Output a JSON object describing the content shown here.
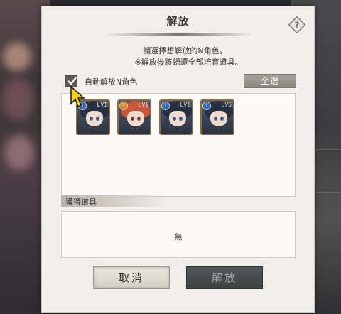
{
  "dialog": {
    "title": "解放",
    "instruction_line1": "請選擇想解放的N角色。",
    "instruction_line2": "※解放後將歸還全部培育道具。"
  },
  "auto_release": {
    "label": "自動解放N角色",
    "checked": true
  },
  "select_all_label": "全選",
  "characters": [
    {
      "level": "LV1",
      "badge": "i",
      "hair_color": "#253044"
    },
    {
      "level": "LV1",
      "badge": "!",
      "hair_color": "#c8563c"
    },
    {
      "level": "LV1",
      "badge": "i",
      "hair_color": "#253044"
    },
    {
      "level": "LV6",
      "badge": "i",
      "hair_color": "#253044"
    }
  ],
  "rewards": {
    "header": "獲得道具",
    "empty_text": "無"
  },
  "buttons": {
    "cancel": "取消",
    "release": "解放"
  },
  "colors": {
    "panel_bg": "#f1efeb",
    "card_border": "#8a6c44",
    "select_all_bg": "#a8a29b",
    "release_btn_bg": "#4a4e4f"
  }
}
